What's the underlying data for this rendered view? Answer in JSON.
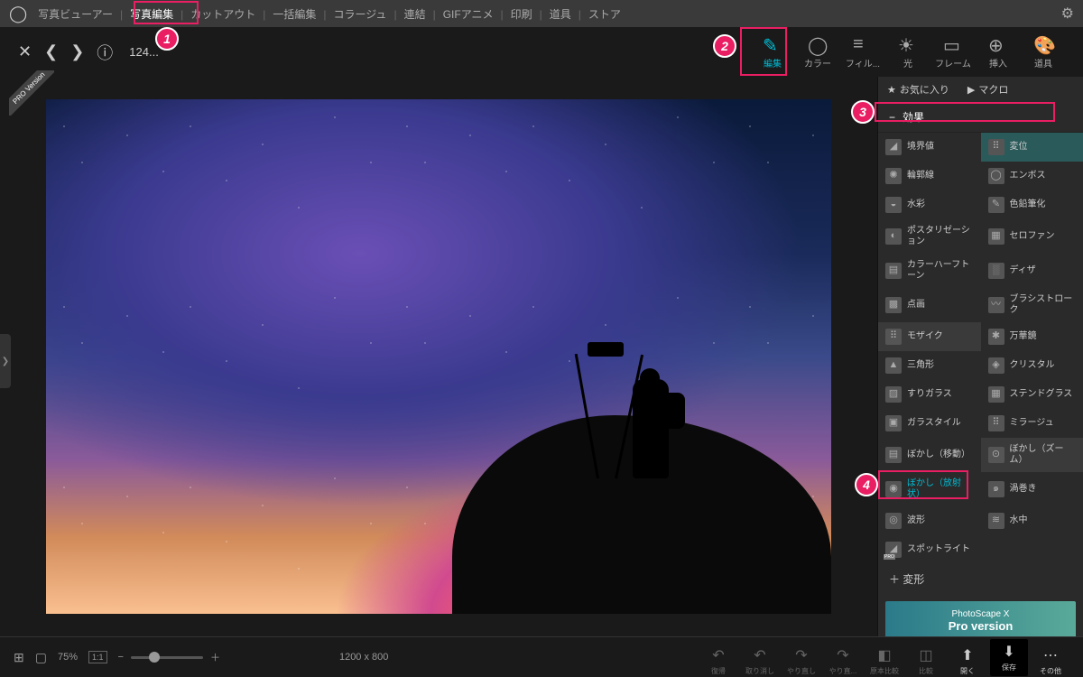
{
  "topbar": {
    "items": [
      "写真ビューアー",
      "写真編集",
      "カットアウト",
      "一括編集",
      "コラージュ",
      "連結",
      "GIFアニメ",
      "印刷",
      "道具",
      "ストア"
    ],
    "active_index": 1
  },
  "secondbar": {
    "file_counter": "124..."
  },
  "tools": [
    {
      "label": "編集",
      "active": true
    },
    {
      "label": "カラー",
      "active": false
    },
    {
      "label": "フィル...",
      "active": false
    },
    {
      "label": "光",
      "active": false
    },
    {
      "label": "フレーム",
      "active": false
    },
    {
      "label": "挿入",
      "active": false
    },
    {
      "label": "道具",
      "active": false
    }
  ],
  "side_tabs": {
    "fav": "お気に入り",
    "macro": "マクロ"
  },
  "section": {
    "effects": "効果"
  },
  "effects": [
    {
      "l": "境界値",
      "icon": "◢"
    },
    {
      "l": "変位",
      "sel": "sel1",
      "icon": "⠿"
    },
    {
      "l": "輪郭線",
      "icon": "✺"
    },
    {
      "l": "エンボス",
      "icon": "◯"
    },
    {
      "l": "水彩",
      "icon": "◒"
    },
    {
      "l": "色鉛筆化",
      "icon": "✎"
    },
    {
      "l": "ポスタリゼーション",
      "icon": "◐"
    },
    {
      "l": "セロファン",
      "icon": "▦"
    },
    {
      "l": "カラーハーフトーン",
      "icon": "▤"
    },
    {
      "l": "ディザ",
      "icon": "░"
    },
    {
      "l": "点画",
      "icon": "▩"
    },
    {
      "l": "ブラシストローク",
      "icon": "〰"
    },
    {
      "l": "モザイク",
      "sel": "sel2",
      "icon": "⠿"
    },
    {
      "l": "万華鏡",
      "icon": "✱"
    },
    {
      "l": "三角形",
      "icon": "▲"
    },
    {
      "l": "クリスタル",
      "icon": "◈"
    },
    {
      "l": "すりガラス",
      "icon": "▨"
    },
    {
      "l": "ステンドグラス",
      "icon": "▦"
    },
    {
      "l": "ガラスタイル",
      "icon": "▣"
    },
    {
      "l": "ミラージュ",
      "icon": "⠿"
    },
    {
      "l": "ぼかし（移動）",
      "icon": "▤"
    },
    {
      "l": "ぼかし（ズーム）",
      "sel": "sel2",
      "icon": "⊙"
    },
    {
      "l": "ぼかし（放射状）",
      "sel": "sel3",
      "icon": "◉"
    },
    {
      "l": "渦巻き",
      "icon": "๑"
    },
    {
      "l": "波形",
      "icon": "◎"
    },
    {
      "l": "水中",
      "icon": "≋"
    },
    {
      "l": "スポットライト",
      "pro": true,
      "icon": "◢"
    },
    {
      "l": "",
      "empty": true
    }
  ],
  "transform": "変形",
  "pro_banner": {
    "line1": "PhotoScape X",
    "line2": "Pro version"
  },
  "pro_ribbon": "PRO Version",
  "bottombar": {
    "zoom_pct": "75%",
    "ratio": "1:1",
    "dims": "1200 x 800",
    "tools": [
      {
        "l": "復帰"
      },
      {
        "l": "取り消し"
      },
      {
        "l": "やり直し"
      },
      {
        "l": "やり直..."
      },
      {
        "l": "原本比較"
      },
      {
        "l": "比較"
      },
      {
        "l": "開く",
        "en": true
      },
      {
        "l": "保存",
        "en": true,
        "primary": true
      },
      {
        "l": "その他",
        "en": true
      }
    ]
  },
  "callouts": {
    "c1": "1",
    "c2": "2",
    "c3": "3",
    "c4": "4"
  }
}
